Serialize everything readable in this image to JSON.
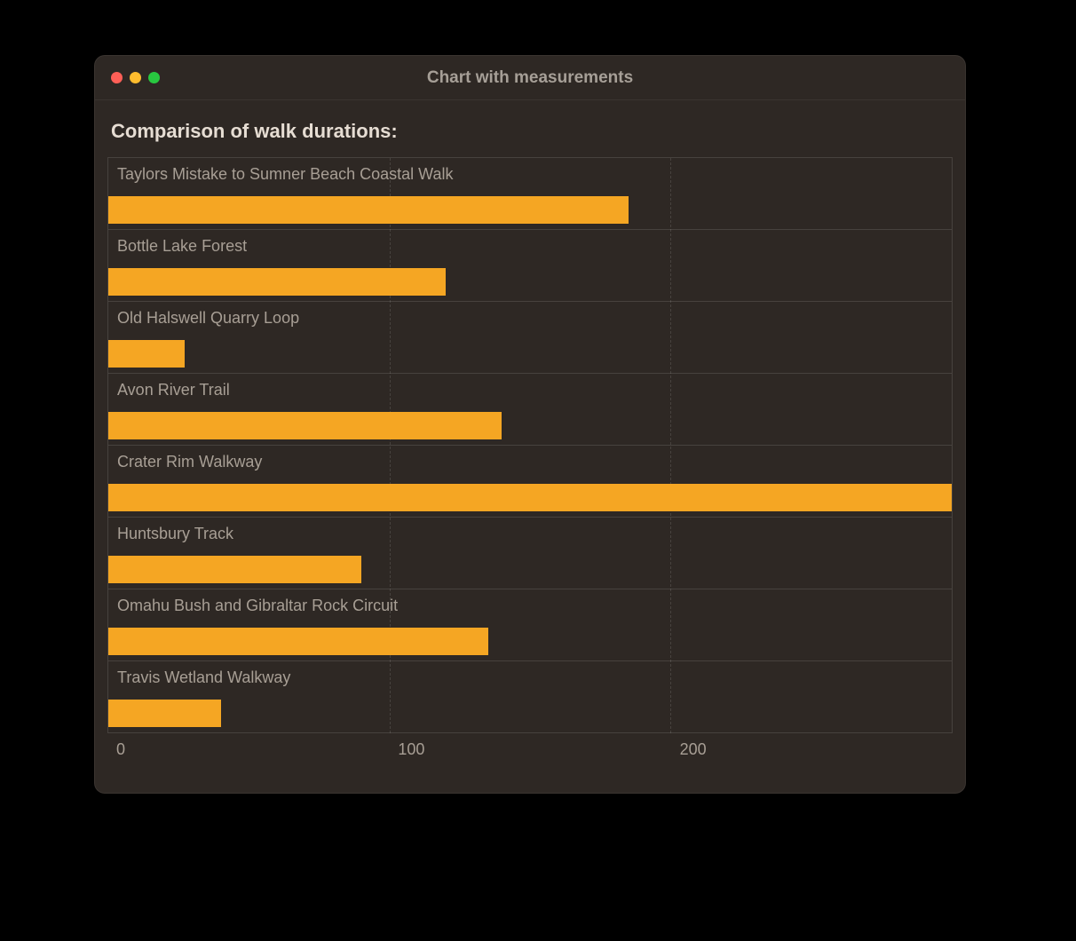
{
  "window": {
    "title": "Chart with measurements"
  },
  "heading": "Comparison of walk durations:",
  "chart_data": {
    "type": "bar",
    "orientation": "horizontal",
    "categories": [
      "Taylors Mistake to Sumner Beach Coastal Walk",
      "Bottle Lake Forest",
      "Old Halswell Quarry Loop",
      "Avon River Trail",
      "Crater Rim Walkway",
      "Huntsbury Track",
      "Omahu Bush and Gibraltar Rock Circuit",
      "Travis Wetland Walkway"
    ],
    "values": [
      185,
      120,
      27,
      140,
      300,
      90,
      135,
      40
    ],
    "xlabel": "",
    "ylabel": "",
    "title": "",
    "xlim": [
      0,
      300
    ],
    "ticks": [
      0,
      100,
      200
    ],
    "bar_color": "#f5a623"
  }
}
